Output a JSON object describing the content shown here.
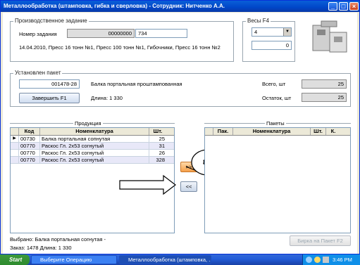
{
  "window": {
    "title": "Металлообработка (штамповка, гибка и сверловка) - Сотрудник: Нитченко А.А."
  },
  "task": {
    "group_label": "Производственное задание",
    "number_label": "Номер задания",
    "number_value": "00000000",
    "number_suffix": "734",
    "description": "14.04.2010, Пресс 16 тонн №1, Пресс 100 тонн №1, Гибочники, Пресс 16 тонн №2"
  },
  "scales": {
    "group_label": "Весы  F4",
    "selected": "4",
    "weight": "0"
  },
  "packet": {
    "group_label": "Установлен пакет",
    "code": "001478-28",
    "name": "Балка портальная проштампованная",
    "length_label": "Длина:",
    "length_value": "1 330",
    "finish_button": "Завершить   F1",
    "total_label": "Всего, шт",
    "total_value": "25",
    "rest_label": "Остаток, шт",
    "rest_value": "25"
  },
  "products": {
    "label": "Продукция",
    "columns": [
      "Код",
      "Номенклатура",
      "Шт."
    ],
    "rows": [
      {
        "code": "00730",
        "name": "Балка портальная сопнутая",
        "qty": "25"
      },
      {
        "code": "00770",
        "name": "Раскос Гл. 2х53 согнутый",
        "qty": "31"
      },
      {
        "code": "00770",
        "name": "Раскос Гл. 2х53 согнутый",
        "qty": "26"
      },
      {
        "code": "00770",
        "name": "Раскос Гл. 2х53 согнутый",
        "qty": "328"
      }
    ]
  },
  "packets": {
    "label": "Пакеты",
    "columns": [
      "Пак.",
      "Номенклатура",
      "Шт.",
      "К."
    ]
  },
  "transfer": {
    "forward": ">>",
    "back": "<<"
  },
  "annotation": {
    "number": "8"
  },
  "footer": {
    "selected": "Выбрано: Балка портальная согнутая -",
    "order": "Заказ: 1478  Длина: 1 330",
    "label_button": "Бирка на Пакет  F2"
  },
  "taskbar": {
    "start": "Start",
    "items": [
      "Выберите Операцию",
      "Металлообработка (штамповка, ..."
    ],
    "clock": "3:46 PM"
  }
}
